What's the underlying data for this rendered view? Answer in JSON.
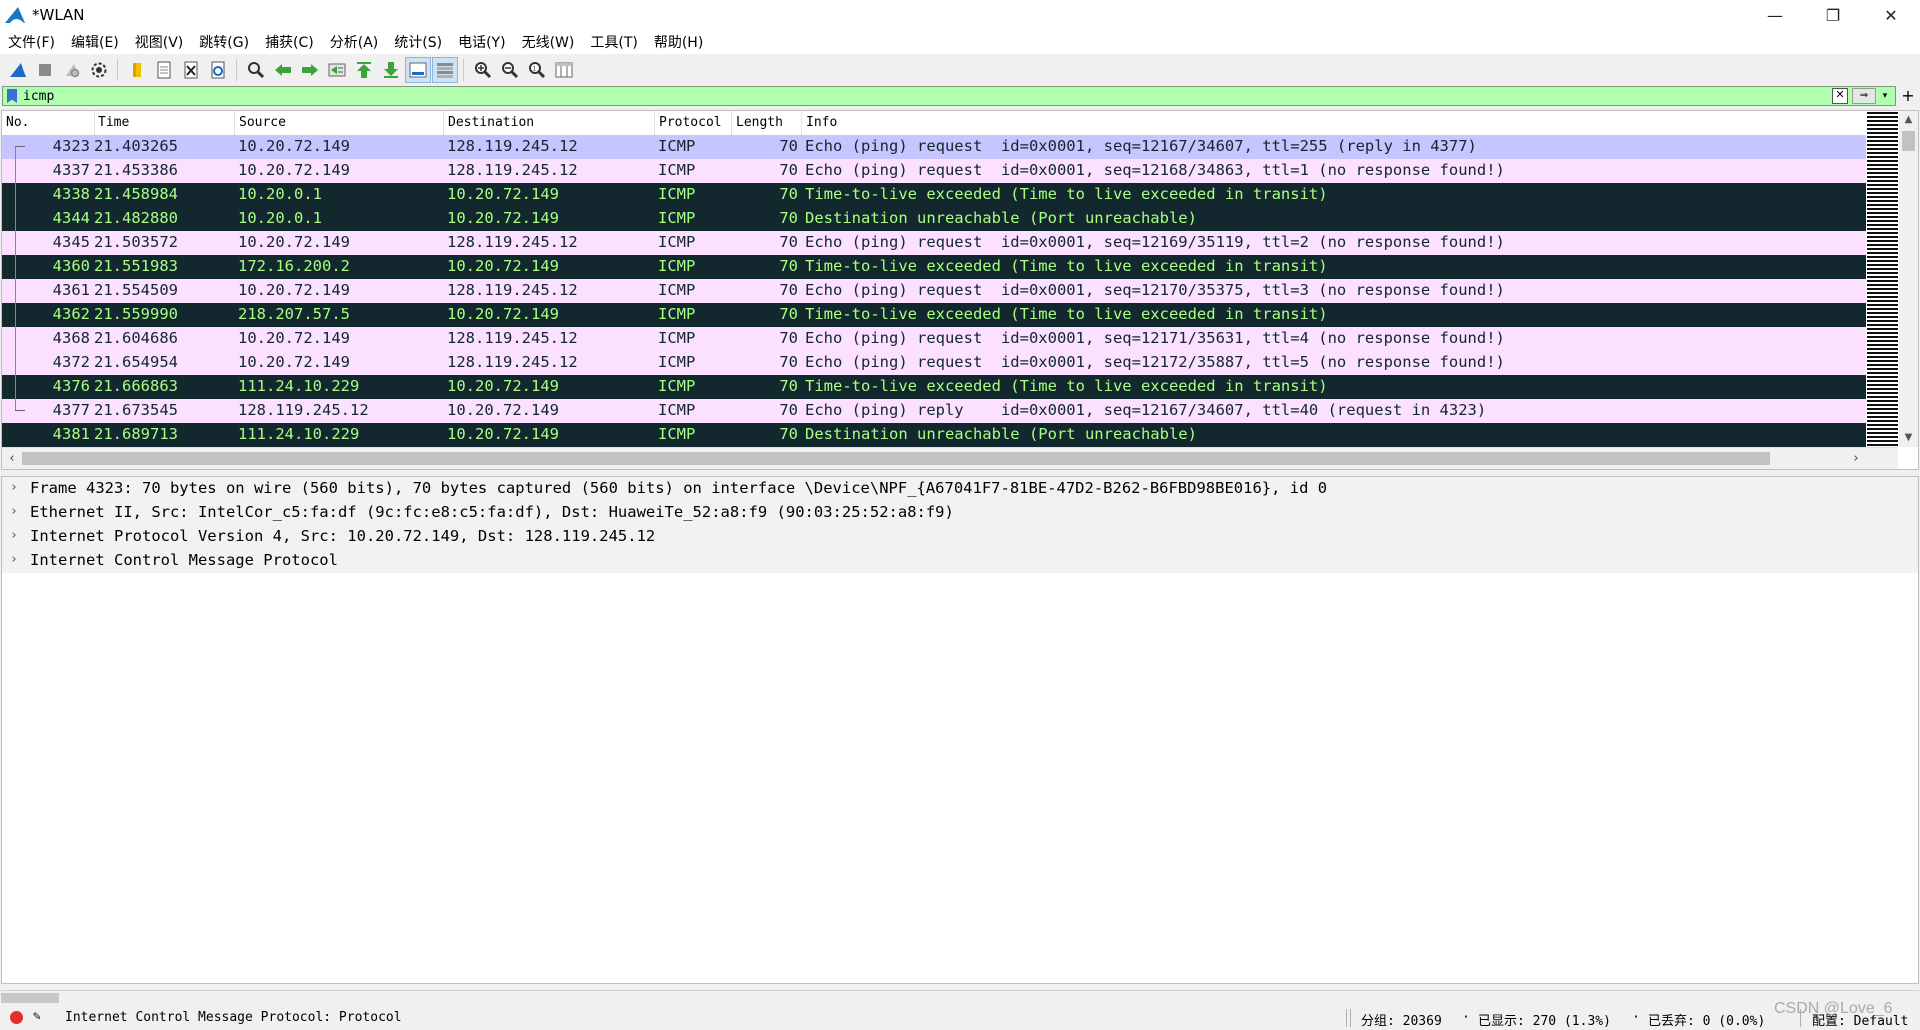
{
  "window": {
    "title": "*WLAN",
    "minimize": "—",
    "restore": "❐",
    "close": "✕"
  },
  "menu": [
    "文件(F)",
    "编辑(E)",
    "视图(V)",
    "跳转(G)",
    "捕获(C)",
    "分析(A)",
    "统计(S)",
    "电话(Y)",
    "无线(W)",
    "工具(T)",
    "帮助(H)"
  ],
  "filter": {
    "value": "icmp",
    "clear": "✕",
    "apply": "⇒",
    "dropdown": "▾",
    "add": "+"
  },
  "columns": {
    "no": "No.",
    "time": "Time",
    "source": "Source",
    "destination": "Destination",
    "protocol": "Protocol",
    "length": "Length",
    "info": "Info"
  },
  "packets": [
    {
      "no": "4323",
      "time": "21.403265",
      "source": "10.20.72.149",
      "destination": "128.119.245.12",
      "protocol": "ICMP",
      "length": "70",
      "info": "Echo (ping) request  id=0x0001, seq=12167/34607, ttl=255 (reply in 4377)",
      "style": "selected"
    },
    {
      "no": "4337",
      "time": "21.453386",
      "source": "10.20.72.149",
      "destination": "128.119.245.12",
      "protocol": "ICMP",
      "length": "70",
      "info": "Echo (ping) request  id=0x0001, seq=12168/34863, ttl=1 (no response found!)",
      "style": "light"
    },
    {
      "no": "4338",
      "time": "21.458984",
      "source": "10.20.0.1",
      "destination": "10.20.72.149",
      "protocol": "ICMP",
      "length": "70",
      "info": "Time-to-live exceeded (Time to live exceeded in transit)",
      "style": "dark"
    },
    {
      "no": "4344",
      "time": "21.482880",
      "source": "10.20.0.1",
      "destination": "10.20.72.149",
      "protocol": "ICMP",
      "length": "70",
      "info": "Destination unreachable (Port unreachable)",
      "style": "dark"
    },
    {
      "no": "4345",
      "time": "21.503572",
      "source": "10.20.72.149",
      "destination": "128.119.245.12",
      "protocol": "ICMP",
      "length": "70",
      "info": "Echo (ping) request  id=0x0001, seq=12169/35119, ttl=2 (no response found!)",
      "style": "light"
    },
    {
      "no": "4360",
      "time": "21.551983",
      "source": "172.16.200.2",
      "destination": "10.20.72.149",
      "protocol": "ICMP",
      "length": "70",
      "info": "Time-to-live exceeded (Time to live exceeded in transit)",
      "style": "dark"
    },
    {
      "no": "4361",
      "time": "21.554509",
      "source": "10.20.72.149",
      "destination": "128.119.245.12",
      "protocol": "ICMP",
      "length": "70",
      "info": "Echo (ping) request  id=0x0001, seq=12170/35375, ttl=3 (no response found!)",
      "style": "light"
    },
    {
      "no": "4362",
      "time": "21.559990",
      "source": "218.207.57.5",
      "destination": "10.20.72.149",
      "protocol": "ICMP",
      "length": "70",
      "info": "Time-to-live exceeded (Time to live exceeded in transit)",
      "style": "dark"
    },
    {
      "no": "4368",
      "time": "21.604686",
      "source": "10.20.72.149",
      "destination": "128.119.245.12",
      "protocol": "ICMP",
      "length": "70",
      "info": "Echo (ping) request  id=0x0001, seq=12171/35631, ttl=4 (no response found!)",
      "style": "light"
    },
    {
      "no": "4372",
      "time": "21.654954",
      "source": "10.20.72.149",
      "destination": "128.119.245.12",
      "protocol": "ICMP",
      "length": "70",
      "info": "Echo (ping) request  id=0x0001, seq=12172/35887, ttl=5 (no response found!)",
      "style": "light"
    },
    {
      "no": "4376",
      "time": "21.666863",
      "source": "111.24.10.229",
      "destination": "10.20.72.149",
      "protocol": "ICMP",
      "length": "70",
      "info": "Time-to-live exceeded (Time to live exceeded in transit)",
      "style": "dark"
    },
    {
      "no": "4377",
      "time": "21.673545",
      "source": "128.119.245.12",
      "destination": "10.20.72.149",
      "protocol": "ICMP",
      "length": "70",
      "info": "Echo (ping) reply    id=0x0001, seq=12167/34607, ttl=40 (request in 4323)",
      "style": "light"
    },
    {
      "no": "4381",
      "time": "21.689713",
      "source": "111.24.10.229",
      "destination": "10.20.72.149",
      "protocol": "ICMP",
      "length": "70",
      "info": "Destination unreachable (Port unreachable)",
      "style": "dark"
    }
  ],
  "details": [
    "Frame 4323: 70 bytes on wire (560 bits), 70 bytes captured (560 bits) on interface \\Device\\NPF_{A67041F7-81BE-47D2-B262-B6FBD98BE016}, id 0",
    "Ethernet II, Src: IntelCor_c5:fa:df (9c:fc:e8:c5:fa:df), Dst: HuaweiTe_52:a8:f9 (90:03:25:52:a8:f9)",
    "Internet Protocol Version 4, Src: 10.20.72.149, Dst: 128.119.245.12",
    "Internet Control Message Protocol"
  ],
  "status": {
    "message": "Internet Control Message Protocol: Protocol",
    "packets": "分组: 20369",
    "displayed": "已显示: 270 (1.3%)",
    "dropped": "已丢弃: 0 (0.0%)",
    "profile": "配置: Default"
  },
  "watermark": "CSDN @Love_6",
  "colors": {
    "filter_bg": "#afffaf",
    "row_light": "#fce0ff",
    "row_dark": "#12272e",
    "row_dark_text": "#a8ff80",
    "row_selected": "#c6c5ff"
  }
}
